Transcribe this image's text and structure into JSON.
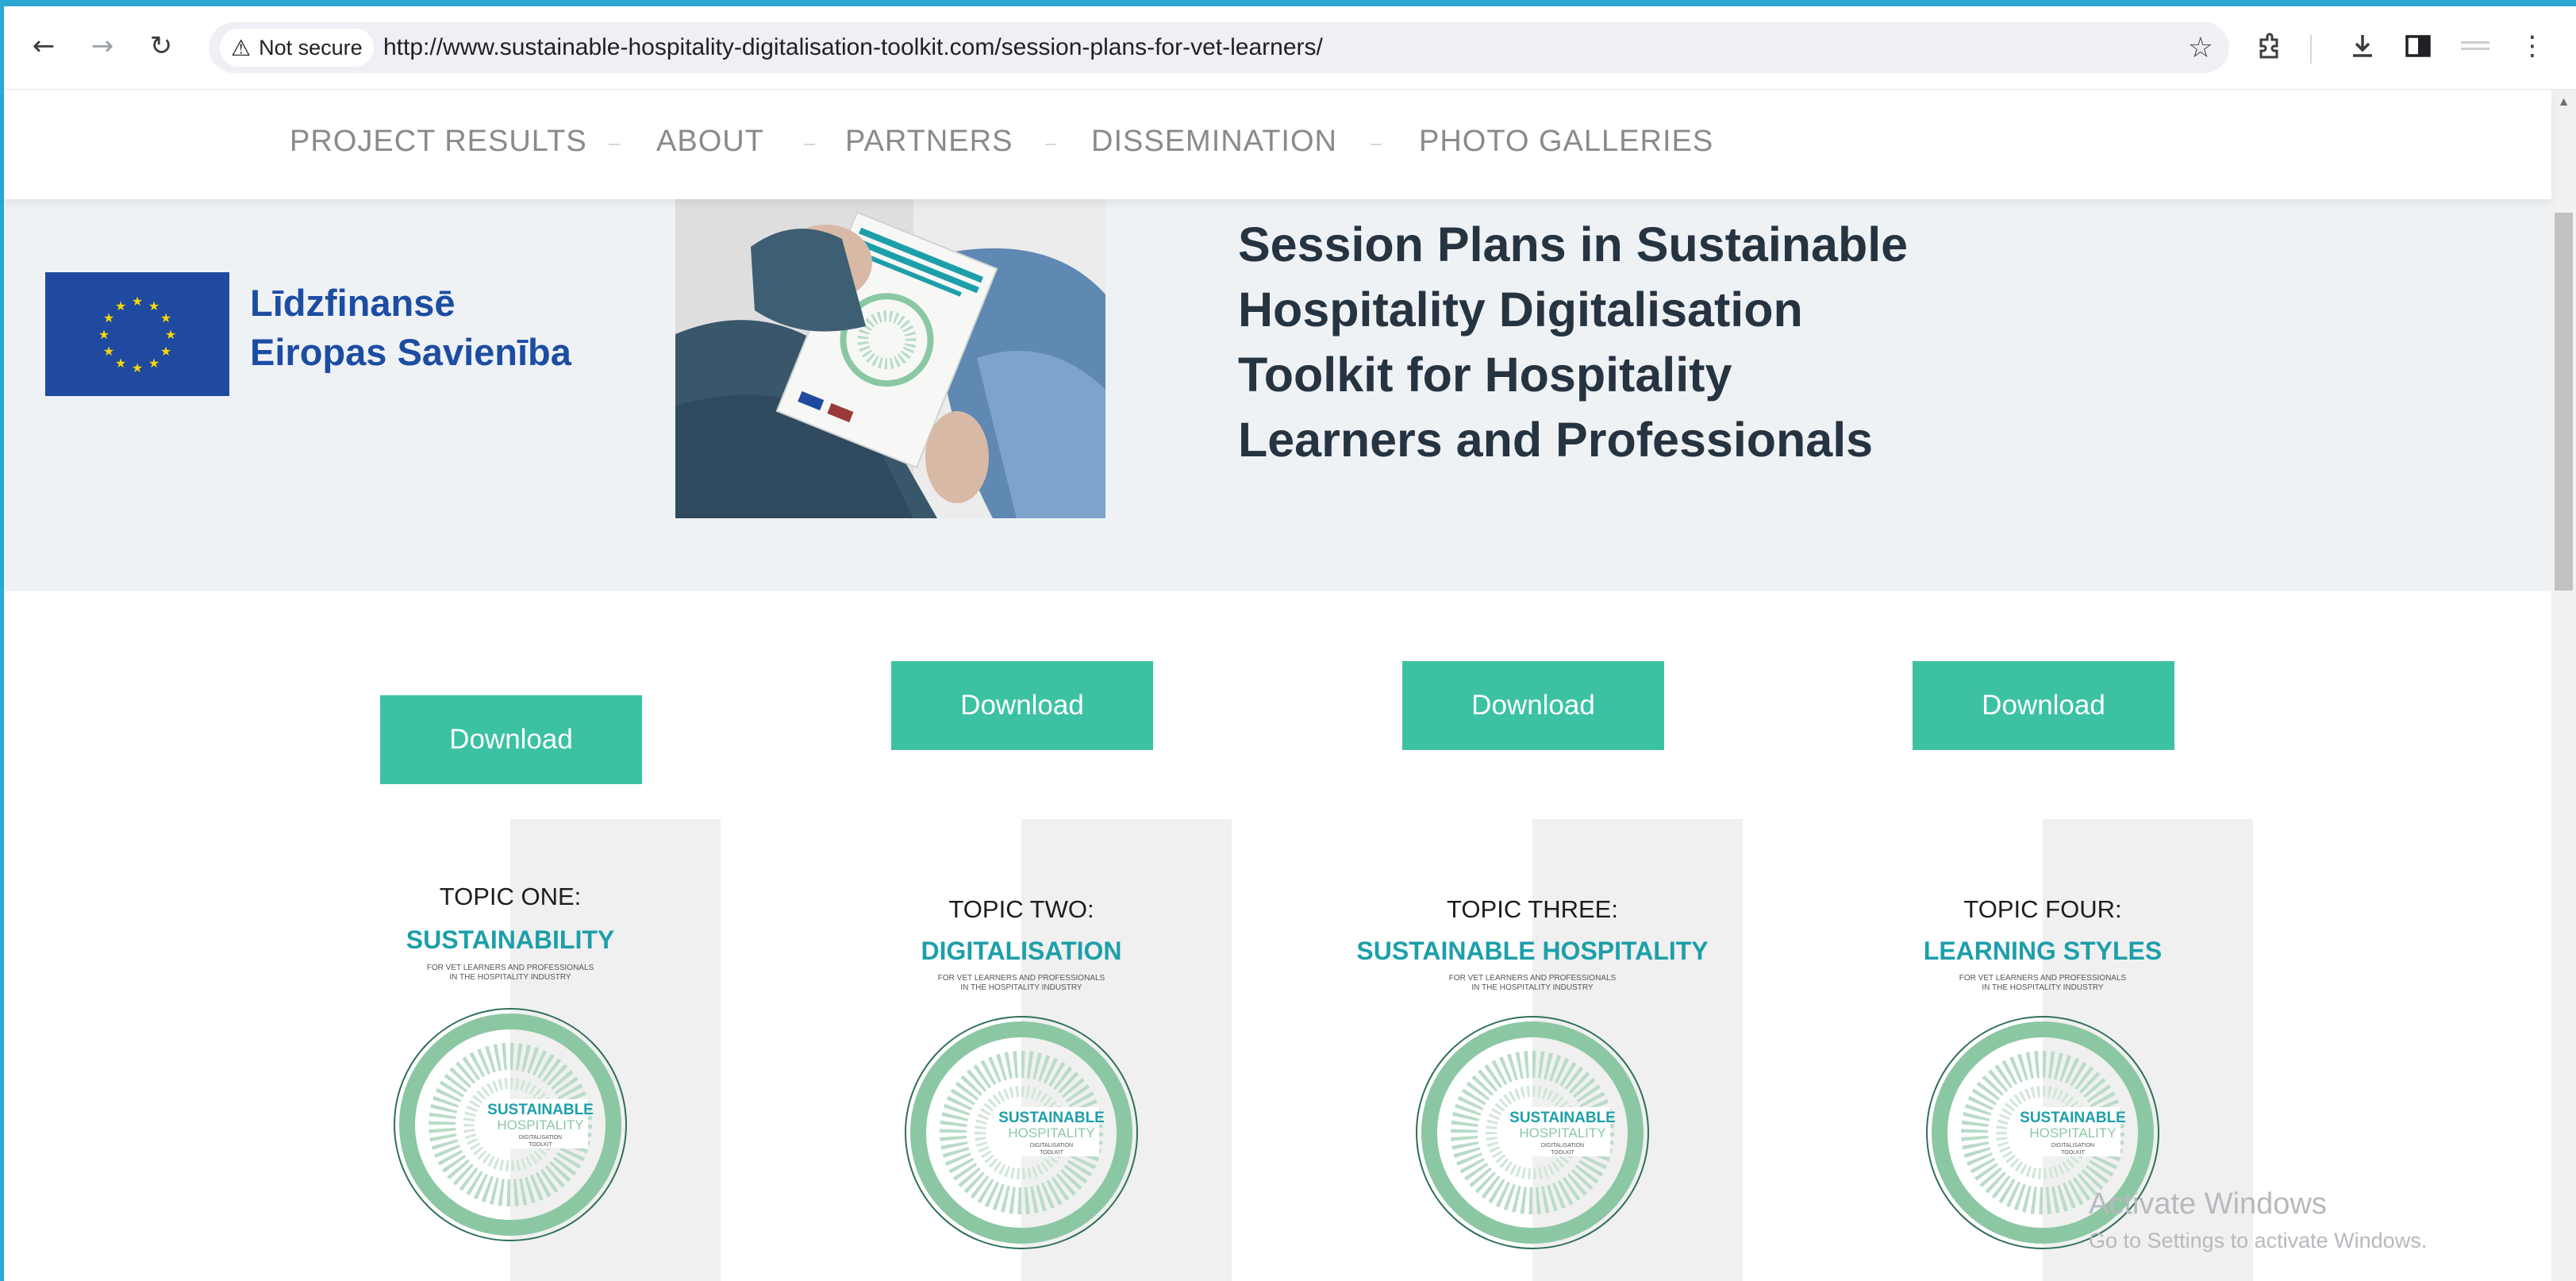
{
  "browser": {
    "security_label": "Not secure",
    "url": "http://www.sustainable-hospitality-digitalisation-toolkit.com/session-plans-for-vet-learners/"
  },
  "nav": {
    "items": [
      "PROJECT RESULTS",
      "ABOUT",
      "PARTNERS",
      "DISSEMINATION",
      "PHOTO GALLERIES"
    ]
  },
  "hero": {
    "eu_line1": "Līdzfinansē",
    "eu_line2": "Eiropas Savienība",
    "title_lines": [
      "Session Plans in Sustainable",
      "Hospitality Digitalisation",
      "Toolkit for Hospitality",
      "Learners and Professionals"
    ]
  },
  "cards": [
    {
      "button": "Download",
      "topic": "TOPIC ONE:",
      "subject": "SUSTAINABILITY"
    },
    {
      "button": "Download",
      "topic": "TOPIC TWO:",
      "subject": "DIGITALISATION"
    },
    {
      "button": "Download",
      "topic": "TOPIC THREE:",
      "subject": "SUSTAINABLE HOSPITALITY"
    },
    {
      "button": "Download",
      "topic": "TOPIC FOUR:",
      "subject": "LEARNING STYLES"
    }
  ],
  "card_small_text": [
    "FOR VET LEARNERS AND PROFESSIONALS",
    "IN THE HOSPITALITY INDUSTRY"
  ],
  "card_logo_text": [
    "SUSTAINABLE",
    "HOSPITALITY",
    "DIGITALISATION",
    "TOOLKIT"
  ],
  "watermark": {
    "line1": "Activate Windows",
    "line2": "Go to Settings to activate Windows."
  },
  "colors": {
    "accent_button": "#3cc2a3",
    "eu_blue": "#1c4da3",
    "topic_teal": "#1d9faa",
    "logo_ring": "#8cc7a3"
  },
  "icons": [
    "back-icon",
    "forward-icon",
    "reload-icon",
    "warning-icon",
    "star-icon",
    "extensions-icon",
    "download-icon",
    "sidepanel-icon",
    "profile-icon",
    "menu-icon"
  ]
}
